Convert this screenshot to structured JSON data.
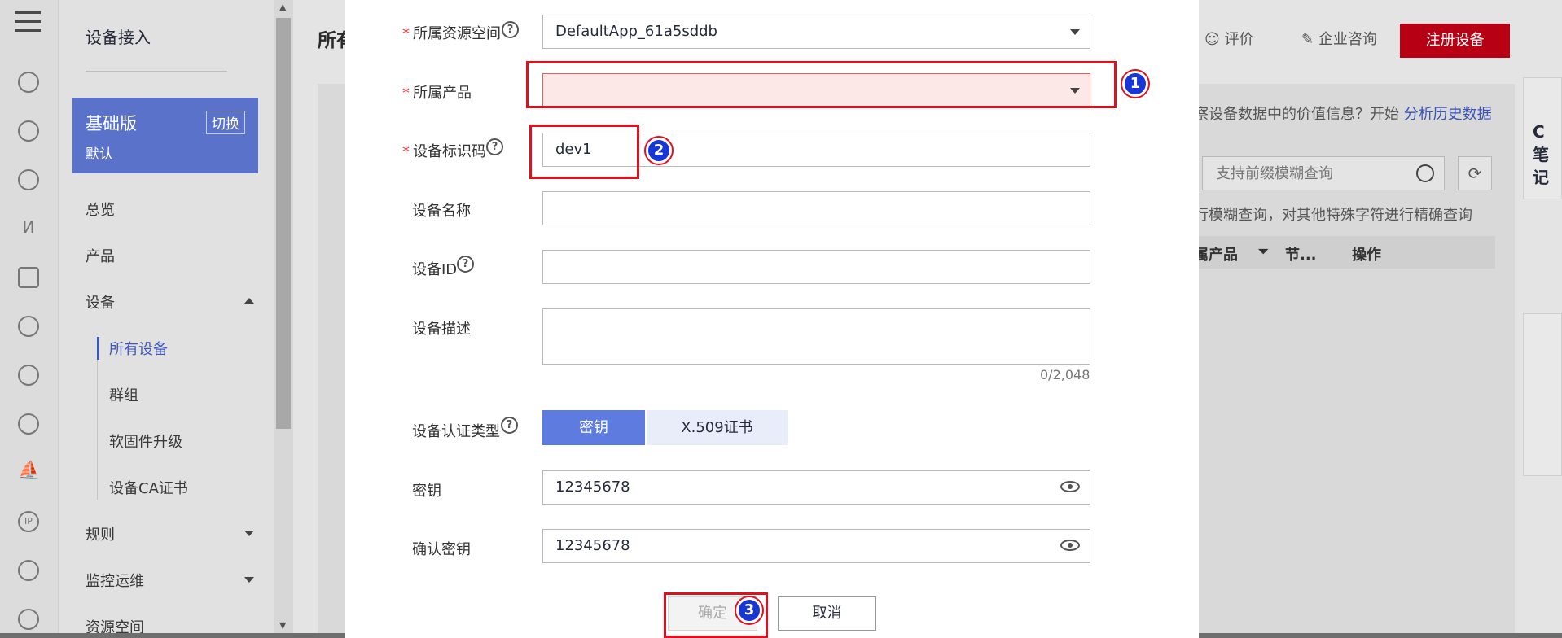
{
  "sidebar": {
    "title": "设备接入",
    "edition_name": "基础版",
    "edition_switch": "切换",
    "edition_default": "默认",
    "items": [
      {
        "label": "总览"
      },
      {
        "label": "产品"
      },
      {
        "label": "设备"
      },
      {
        "label": "规则"
      },
      {
        "label": "监控运维"
      },
      {
        "label": "资源空间"
      }
    ],
    "sub_items": [
      {
        "label": "所有设备"
      },
      {
        "label": "群组"
      },
      {
        "label": "软固件升级"
      },
      {
        "label": "设备CA证书"
      }
    ]
  },
  "background": {
    "page_title": "所有",
    "rate_label": "评价",
    "consult_label": "企业咨询",
    "register_button": "注册设备",
    "hint_prefix": "察设备数据中的价值信息？开始",
    "hint_link": "分析历史数据",
    "search_placeholder": "支持前缀模糊查询",
    "search_hint": "行模糊查询，对其他特殊字符进行精确查询",
    "columns": [
      "属产品",
      "节...",
      "操作"
    ],
    "float_chars": "C笔记"
  },
  "form": {
    "resource_space": {
      "label": "所属资源空间",
      "value": "DefaultApp_61a5sddb"
    },
    "product": {
      "label": "所属产品",
      "value": ""
    },
    "node_id": {
      "label": "设备标识码",
      "value": "dev1"
    },
    "device_name": {
      "label": "设备名称",
      "value": ""
    },
    "device_id": {
      "label": "设备ID",
      "value": ""
    },
    "description": {
      "label": "设备描述",
      "value": "",
      "counter": "0/2,048"
    },
    "auth_type": {
      "label": "设备认证类型",
      "options": [
        "密钥",
        "X.509证书"
      ],
      "selected": "密钥"
    },
    "secret": {
      "label": "密钥",
      "value": "12345678"
    },
    "confirm_secret": {
      "label": "确认密钥",
      "value": "12345678"
    },
    "ok_button": "确定",
    "cancel_button": "取消"
  },
  "annotations": {
    "badge1": "1",
    "badge2": "2",
    "badge3": "3"
  },
  "colors": {
    "primary": "#5e7ce0",
    "danger": "#e0101e",
    "brand": "#b80014",
    "badge": "#1835d6"
  }
}
